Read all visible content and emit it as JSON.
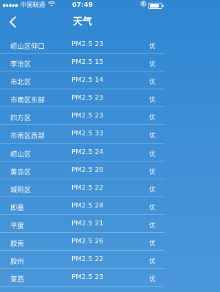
{
  "status_bar": {
    "carrier": "中国联通",
    "time": "07:49",
    "battery_level": 0.85
  },
  "nav": {
    "title": "天气"
  },
  "rows": [
    {
      "district": "崂山区仰口",
      "pm": "PM2.5 23",
      "quality": "优"
    },
    {
      "district": "李沧区",
      "pm": "PM2.5 15",
      "quality": "优"
    },
    {
      "district": "市北区",
      "pm": "PM2.5 14",
      "quality": "优"
    },
    {
      "district": "市南区东部",
      "pm": "PM2.5 23",
      "quality": "优"
    },
    {
      "district": "四方区",
      "pm": "PM2.5 23",
      "quality": "优"
    },
    {
      "district": "市南区西部",
      "pm": "PM2.5 33",
      "quality": "优"
    },
    {
      "district": "崂山区",
      "pm": "PM2.5 24",
      "quality": "优"
    },
    {
      "district": "黄岛区",
      "pm": "PM2.5 20",
      "quality": "优"
    },
    {
      "district": "城阳区",
      "pm": "PM2.5 22",
      "quality": "优"
    },
    {
      "district": "即墨",
      "pm": "PM2.5 24",
      "quality": "优"
    },
    {
      "district": "平度",
      "pm": "PM2.5 21",
      "quality": "优"
    },
    {
      "district": "胶南",
      "pm": "PM2.5 26",
      "quality": "优"
    },
    {
      "district": "胶州",
      "pm": "PM2.5 22",
      "quality": "优"
    },
    {
      "district": "莱西",
      "pm": "PM2.5 23",
      "quality": "优"
    }
  ]
}
